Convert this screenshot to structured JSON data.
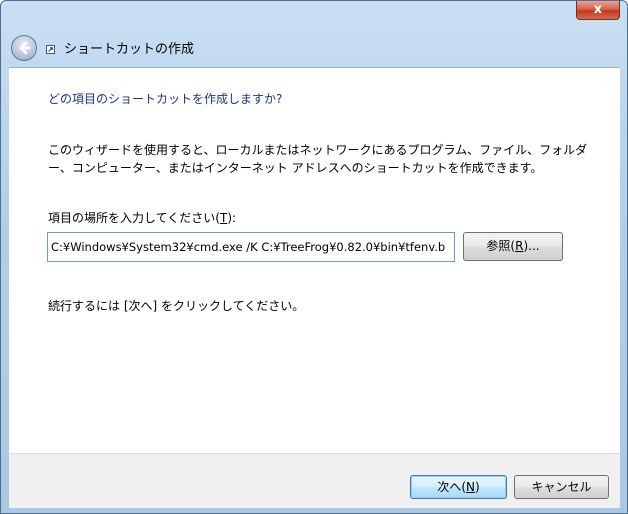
{
  "window": {
    "title": "ショートカットの作成",
    "close_label": "x"
  },
  "wizard": {
    "heading": "どの項目のショートカットを作成しますか?",
    "description": "このウィザードを使用すると、ローカルまたはネットワークにあるプログラム、ファイル、フォルダー、コンピューター、またはインターネット アドレスへのショートカットを作成できます。",
    "location_label_pre": "項目の場所を入力してください(",
    "location_label_key": "T",
    "location_label_post": "):",
    "location_value": "C:¥Windows¥System32¥cmd.exe /K C:¥TreeFrog¥0.82.0¥bin¥tfenv.b",
    "browse_label_pre": "参照(",
    "browse_label_key": "R",
    "browse_label_post": ")...",
    "instruction": "続行するには [次へ] をクリックしてください。"
  },
  "footer": {
    "next_label_pre": "次へ(",
    "next_label_key": "N",
    "next_label_post": ")",
    "cancel_label": "キャンセル"
  },
  "icons": {
    "back": "back-arrow-icon",
    "shortcut": "shortcut-overlay-icon",
    "close": "close-icon"
  }
}
